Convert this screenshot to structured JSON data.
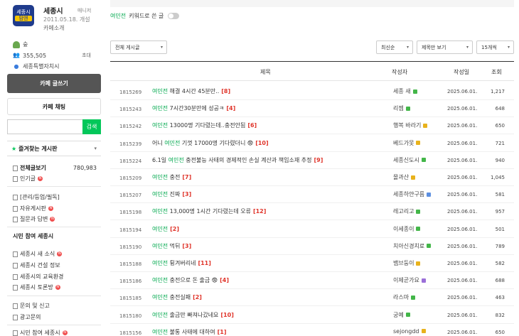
{
  "cafe": {
    "logo_line1": "세종시",
    "logo_line2": "맘앤",
    "name": "세종시",
    "role": "매니저",
    "date": "2011.05.18. 개설",
    "intro": "카페소개",
    "level_label": "숲",
    "members": "355,505",
    "invite": "초대",
    "region": "세종특별자치시"
  },
  "buttons": {
    "write": "카페 글쓰기",
    "chat": "카페 채팅",
    "search": "검색"
  },
  "search": {
    "value": ""
  },
  "favorites": {
    "title": "즐겨찾는 게시판"
  },
  "menu": {
    "all_posts": "전체글보기",
    "all_posts_count": "780,983",
    "popular": "인기글",
    "m1": "[관리/등업/필독]",
    "m2": "자유게시판",
    "m3": "질문과 답변",
    "group_title": "시민 참여 세종시",
    "m4": "세종시 새 소식",
    "m5": "세종시 건설 정보",
    "m6": "세종시의 교육환경",
    "m7": "세종시 토론방",
    "m8": "문의 및 신고",
    "m9": "광고문의",
    "m10": "시민 참여 세종시"
  },
  "filter": {
    "keyword": "여민전",
    "keyword_suffix": "키워드로 쓴 글",
    "board_select": "전체 게시글",
    "sort_select": "최신순",
    "view_select": "제목만 보기",
    "count_select": "15개씩"
  },
  "table": {
    "headers": {
      "title": "제목",
      "author": "작성자",
      "date": "작성일",
      "views": "조회"
    },
    "rows": [
      {
        "num": "1815269",
        "pre": "",
        "kw": "여민전",
        "post": " 해결 4시간 45분만..",
        "cc": "[8]",
        "author": "세종 새",
        "lvl": "#43b649",
        "date": "2025.06.01.",
        "views": "1,217"
      },
      {
        "num": "1815243",
        "pre": "",
        "kw": "여민전",
        "post": " 7시간30분만에 성공ㅋ",
        "cc": "[4]",
        "author": "리젬",
        "lvl": "#43b649",
        "date": "2025.06.01.",
        "views": "648"
      },
      {
        "num": "1815242",
        "pre": "",
        "kw": "여민전",
        "post": " 13000명 기다렸는데..충전안됨",
        "cc": "[6]",
        "author": "행복 바라기",
        "lvl": "#e8b21c",
        "date": "2025.06.01.",
        "views": "650"
      },
      {
        "num": "1815239",
        "pre": "어니 ",
        "kw": "여민전",
        "post": " 기껏 17000명 기다렸더니 😨",
        "cc": "[10]",
        "author": "베드가못",
        "lvl": "#e8b21c",
        "date": "2025.06.01.",
        "views": "721"
      },
      {
        "num": "1815224",
        "pre": "6.1일 ",
        "kw": "여민전",
        "post": " 충전불능 사태의 경제적인 손실 계산과 책임소재 추정",
        "cc": "[9]",
        "author": "세종신도시",
        "lvl": "#43b649",
        "date": "2025.06.01.",
        "views": "940"
      },
      {
        "num": "1815209",
        "pre": "",
        "kw": "여민전",
        "post": " 충전",
        "cc": "[7]",
        "author": "몰과산",
        "lvl": "#e8b21c",
        "date": "2025.06.01.",
        "views": "1,045"
      },
      {
        "num": "1815207",
        "pre": "",
        "kw": "여민전",
        "post": " 진짜",
        "cc": "[3]",
        "author": "세종하얀구름",
        "lvl": "#5c8fe0",
        "date": "2025.06.01.",
        "views": "581"
      },
      {
        "num": "1815198",
        "pre": "",
        "kw": "여민전",
        "post": " 13,000명 1시간 기다렸는데 오류",
        "cc": "[12]",
        "author": "레고리고",
        "lvl": "#43b649",
        "date": "2025.06.01.",
        "views": "957"
      },
      {
        "num": "1815194",
        "pre": "",
        "kw": "여민전",
        "post": "",
        "cc": "[2]",
        "author": "이세종이",
        "lvl": "#43b649",
        "date": "2025.06.01.",
        "views": "501"
      },
      {
        "num": "1815190",
        "pre": "",
        "kw": "여민전",
        "post": " 먹뒤",
        "cc": "[3]",
        "author": "치아신경치료",
        "lvl": "#43b649",
        "date": "2025.06.01.",
        "views": "789"
      },
      {
        "num": "1815188",
        "pre": "",
        "kw": "여민전",
        "post": " 튕겨버리네",
        "cc": "[11]",
        "author": "뱀브둥이",
        "lvl": "#e8b21c",
        "date": "2025.06.01.",
        "views": "582"
      },
      {
        "num": "1815186",
        "pre": "",
        "kw": "여민전",
        "post": " 충전으로 돈 출금 😨",
        "cc": "[4]",
        "author": "이제곧가요",
        "lvl": "#9b6fd8",
        "date": "2025.06.01.",
        "views": "688"
      },
      {
        "num": "1815185",
        "pre": "",
        "kw": "여민전",
        "post": " 충전실패",
        "cc": "[2]",
        "author": "라스마",
        "lvl": "#43b649",
        "date": "2025.06.01.",
        "views": "463"
      },
      {
        "num": "1815180",
        "pre": "",
        "kw": "여민전",
        "post": " 출금만 빠져나갔네요",
        "cc": "[10]",
        "author": "궁예",
        "lvl": "#43b649",
        "date": "2025.06.01.",
        "views": "832"
      },
      {
        "num": "1815156",
        "pre": "",
        "kw": "여민전",
        "post": " 불통 사태에 대하여",
        "cc": "[1]",
        "author": "sejongdd",
        "lvl": "#e8b21c",
        "date": "2025.06.01.",
        "views": "650"
      }
    ]
  }
}
